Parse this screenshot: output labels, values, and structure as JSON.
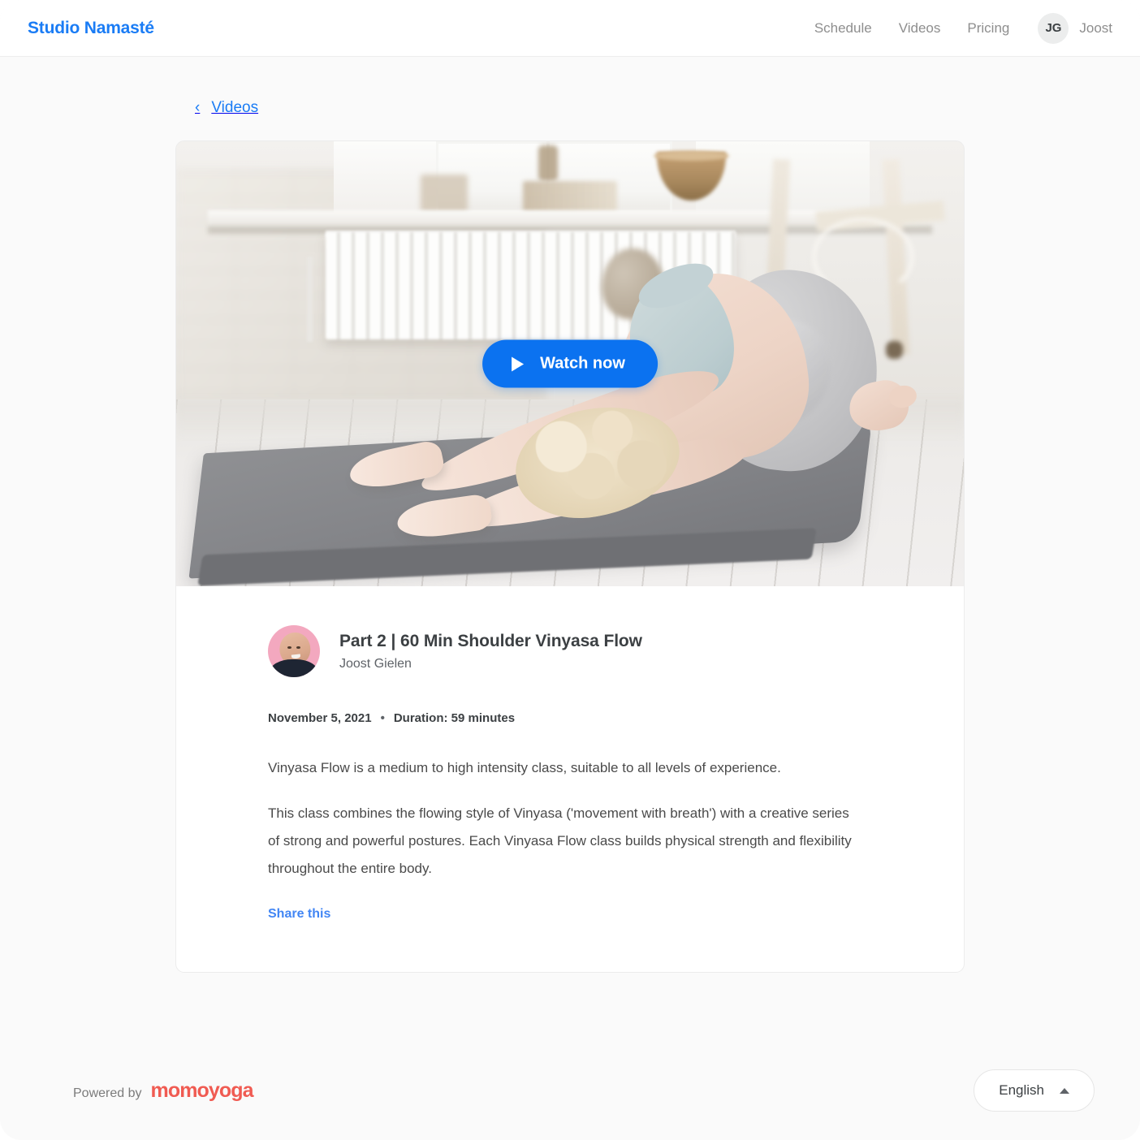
{
  "header": {
    "brand": "Studio Namasté",
    "nav": [
      {
        "label": "Schedule"
      },
      {
        "label": "Videos"
      },
      {
        "label": "Pricing"
      }
    ],
    "user": {
      "initials": "JG",
      "name": "Joost"
    }
  },
  "back": {
    "chevron": "‹",
    "label": "Videos"
  },
  "hero": {
    "watch_label": "Watch now",
    "play_icon": "play-icon"
  },
  "video": {
    "title": "Part 2 | 60 Min Shoulder Vinyasa Flow",
    "author": "Joost Gielen",
    "date": "November 5, 2021",
    "separator": "•",
    "duration": "Duration: 59 minutes",
    "paragraphs": [
      "Vinyasa Flow is a medium to high intensity class, suitable to all levels of experience.",
      "This class combines the flowing style of Vinyasa ('movement with breath') with a creative series of strong and powerful postures. Each Vinyasa Flow class builds physical strength and flexibility throughout the entire body."
    ],
    "share_label": "Share this"
  },
  "footer": {
    "powered_label": "Powered by",
    "brand_logo": "momoyoga",
    "language": "English"
  },
  "colors": {
    "accent_blue": "#1a7cf5",
    "button_blue": "#0b72f0",
    "share_blue": "#4286f4",
    "momo_red": "#f05b52",
    "avatar_pink": "#f3a8bf",
    "page_bg": "#fafafa"
  }
}
